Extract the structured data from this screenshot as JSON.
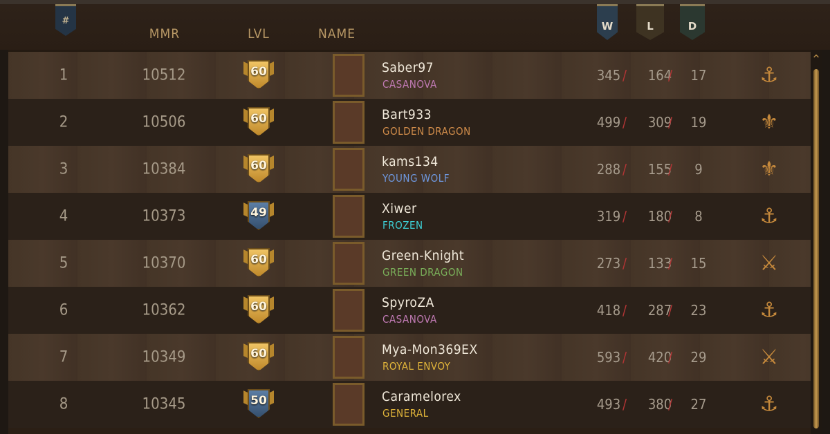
{
  "header": {
    "rank_label": "#",
    "mmr_label": "MMR",
    "lvl_label": "LVL",
    "name_label": "NAME",
    "wins_label": "W",
    "losses_label": "L",
    "draws_label": "D"
  },
  "colors": {
    "casanova": "#c07ab4",
    "golden_dragon": "#d08c4a",
    "young_wolf": "#6e97de",
    "frozen": "#3dd0d6",
    "green_dragon": "#7ab05a",
    "royal_envoy": "#e1b53a",
    "general": "#e1b53a",
    "separator": "#b23535",
    "faction_icon": "#c78a3c"
  },
  "rows": [
    {
      "rank": "1",
      "mmr": "10512",
      "level": "60",
      "badge": "gold",
      "name": "Saber97",
      "title": "CASANOVA",
      "title_color": "#c07ab4",
      "wins": "345",
      "losses": "164",
      "draws": "17",
      "faction_icon": "syndicate-icon"
    },
    {
      "rank": "2",
      "mmr": "10506",
      "level": "60",
      "badge": "gold",
      "name": "Bart933",
      "title": "GOLDEN DRAGON",
      "title_color": "#d08c4a",
      "wins": "499",
      "losses": "309",
      "draws": "19",
      "faction_icon": "nilfgaard-icon"
    },
    {
      "rank": "3",
      "mmr": "10384",
      "level": "60",
      "badge": "gold",
      "name": "kams134",
      "title": "YOUNG WOLF",
      "title_color": "#6e97de",
      "wins": "288",
      "losses": "155",
      "draws": "9",
      "faction_icon": "nilfgaard-icon"
    },
    {
      "rank": "4",
      "mmr": "10373",
      "level": "49",
      "badge": "blue",
      "name": "Xiwer",
      "title": "FROZEN",
      "title_color": "#3dd0d6",
      "wins": "319",
      "losses": "180",
      "draws": "8",
      "faction_icon": "syndicate-icon"
    },
    {
      "rank": "5",
      "mmr": "10370",
      "level": "60",
      "badge": "gold",
      "name": "Green-Knight",
      "title": "GREEN DRAGON",
      "title_color": "#7ab05a",
      "wins": "273",
      "losses": "133",
      "draws": "15",
      "faction_icon": "scoiatael-icon"
    },
    {
      "rank": "6",
      "mmr": "10362",
      "level": "60",
      "badge": "gold",
      "name": "SpyroZA",
      "title": "CASANOVA",
      "title_color": "#c07ab4",
      "wins": "418",
      "losses": "287",
      "draws": "23",
      "faction_icon": "syndicate-icon"
    },
    {
      "rank": "7",
      "mmr": "10349",
      "level": "60",
      "badge": "gold",
      "name": "Mya-Mon369EX",
      "title": "ROYAL ENVOY",
      "title_color": "#e1b53a",
      "wins": "593",
      "losses": "420",
      "draws": "29",
      "faction_icon": "scoiatael-icon"
    },
    {
      "rank": "8",
      "mmr": "10345",
      "level": "50",
      "badge": "blue",
      "name": "Caramelorex",
      "title": "GENERAL",
      "title_color": "#e1b53a",
      "wins": "493",
      "losses": "380",
      "draws": "27",
      "faction_icon": "syndicate-icon"
    }
  ]
}
